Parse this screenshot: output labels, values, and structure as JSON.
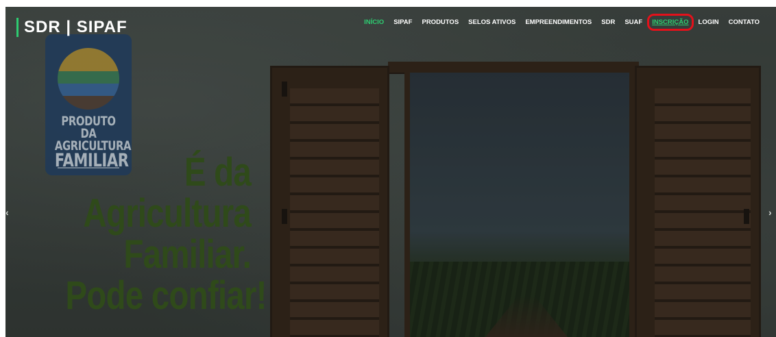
{
  "header": {
    "brand": "SDR | SIPAF",
    "nav": [
      {
        "label": "INÍCIO",
        "state": "active"
      },
      {
        "label": "SIPAF"
      },
      {
        "label": "PRODUTOS"
      },
      {
        "label": "SELOS ATIVOS"
      },
      {
        "label": "EMPREENDIMENTOS"
      },
      {
        "label": "SDR"
      },
      {
        "label": "SUAF"
      },
      {
        "label": "INSCRIÇÃO",
        "state": "highlighted"
      },
      {
        "label": "LOGIN"
      },
      {
        "label": "CONTATO"
      }
    ]
  },
  "hero": {
    "seal": {
      "line1": "PRODUTO DA",
      "line2": "AGRICULTURA",
      "line3": "FAMILIAR"
    },
    "headline": [
      "É da",
      "Agricultura",
      "Familiar.",
      "Pode confiar!"
    ]
  },
  "carousel": {
    "prev_icon": "chevron-left-icon",
    "next_icon": "chevron-right-icon"
  },
  "colors": {
    "accent": "#2ecc71",
    "highlight_box": "#e3111b",
    "headline": "#2f4a1a"
  }
}
